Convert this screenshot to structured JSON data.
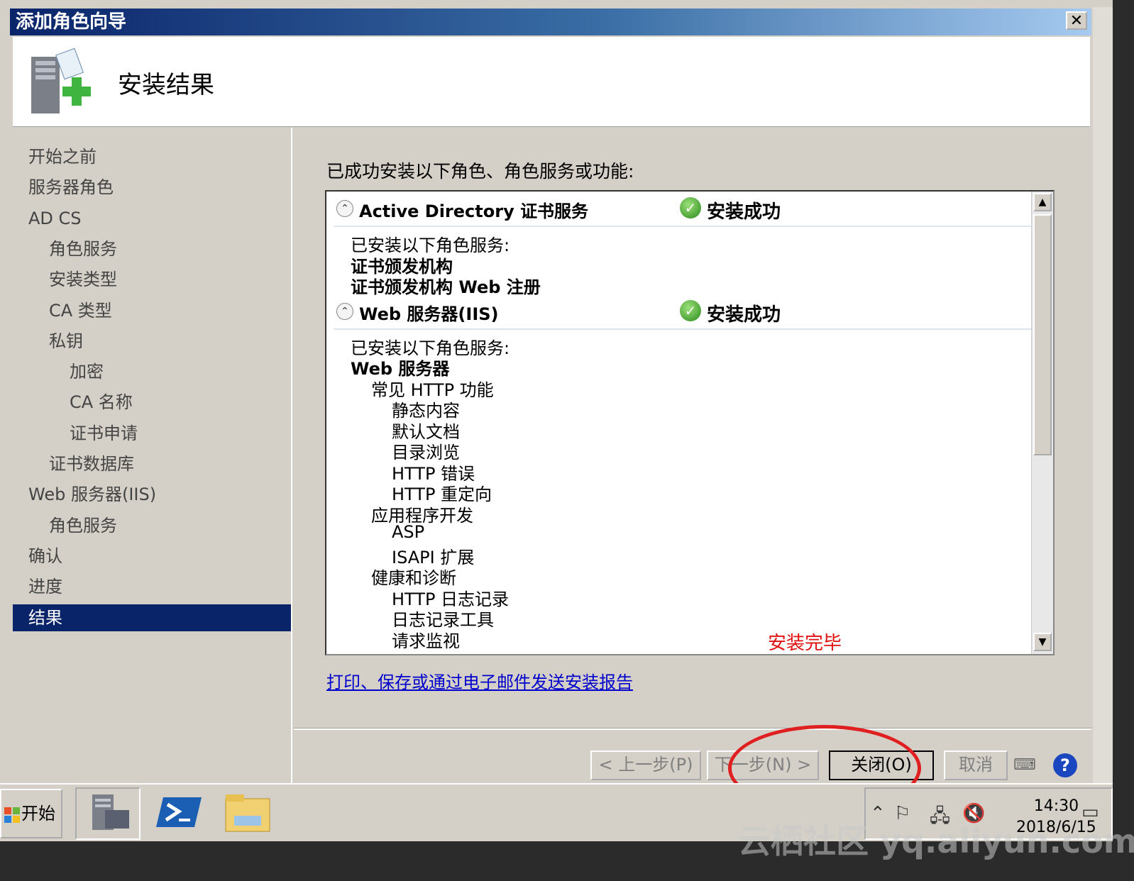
{
  "window": {
    "title": "添加角色向导",
    "close_glyph": "✕",
    "page_title": "安装结果"
  },
  "sidebar": {
    "items": [
      {
        "label": "开始之前",
        "level": 0
      },
      {
        "label": "服务器角色",
        "level": 0
      },
      {
        "label": "AD CS",
        "level": 0
      },
      {
        "label": "角色服务",
        "level": 1
      },
      {
        "label": "安装类型",
        "level": 1
      },
      {
        "label": "CA 类型",
        "level": 1
      },
      {
        "label": "私钥",
        "level": 1
      },
      {
        "label": "加密",
        "level": 2
      },
      {
        "label": "CA 名称",
        "level": 2
      },
      {
        "label": "证书申请",
        "level": 2
      },
      {
        "label": "证书数据库",
        "level": 1
      },
      {
        "label": "Web 服务器(IIS)",
        "level": 0
      },
      {
        "label": "角色服务",
        "level": 1
      },
      {
        "label": "确认",
        "level": 0
      },
      {
        "label": "进度",
        "level": 0
      },
      {
        "label": "结果",
        "level": 0,
        "selected": true
      }
    ]
  },
  "content": {
    "intro": "已成功安装以下角色、角色服务或功能:",
    "sections": [
      {
        "name": "Active Directory 证书服务",
        "status": "安装成功",
        "lines": [
          {
            "text": "已安装以下角色服务:",
            "indent": 0,
            "bold": false
          },
          {
            "text": "证书颁发机构",
            "indent": 0,
            "bold": true
          },
          {
            "text": "证书颁发机构 Web 注册",
            "indent": 0,
            "bold": true
          }
        ]
      },
      {
        "name": "Web 服务器(IIS)",
        "status": "安装成功",
        "lines": [
          {
            "text": "已安装以下角色服务:",
            "indent": 0,
            "bold": false
          },
          {
            "text": "Web 服务器",
            "indent": 0,
            "bold": true
          },
          {
            "text": "常见 HTTP 功能",
            "indent": 1,
            "bold": false
          },
          {
            "text": "静态内容",
            "indent": 2,
            "bold": false
          },
          {
            "text": "默认文档",
            "indent": 2,
            "bold": false
          },
          {
            "text": "目录浏览",
            "indent": 2,
            "bold": false
          },
          {
            "text": "HTTP 错误",
            "indent": 2,
            "bold": false
          },
          {
            "text": "HTTP 重定向",
            "indent": 2,
            "bold": false
          },
          {
            "text": "应用程序开发",
            "indent": 1,
            "bold": false
          },
          {
            "text": "ASP",
            "indent": 2,
            "bold": false
          },
          {
            "text": "ISAPI 扩展",
            "indent": 2,
            "bold": false
          },
          {
            "text": "健康和诊断",
            "indent": 1,
            "bold": false
          },
          {
            "text": "HTTP 日志记录",
            "indent": 2,
            "bold": false
          },
          {
            "text": "日志记录工具",
            "indent": 2,
            "bold": false
          },
          {
            "text": "请求监视",
            "indent": 2,
            "bold": false
          }
        ]
      }
    ],
    "report_link": "打印、保存或通过电子邮件发送安装报告",
    "annotation": "安装完毕"
  },
  "buttons": {
    "back": "< 上一步(P)",
    "next": "下一步(N) >",
    "close": "关闭(O)",
    "cancel": "取消",
    "help": "?"
  },
  "taskbar": {
    "start": "开始",
    "time": "14:30",
    "date": "2018/6/15"
  },
  "watermark": "云栖社区 yq.aliyun.com",
  "colors": {
    "selection": "#0a246a",
    "link": "#0000cc",
    "annotation": "#e01010"
  }
}
